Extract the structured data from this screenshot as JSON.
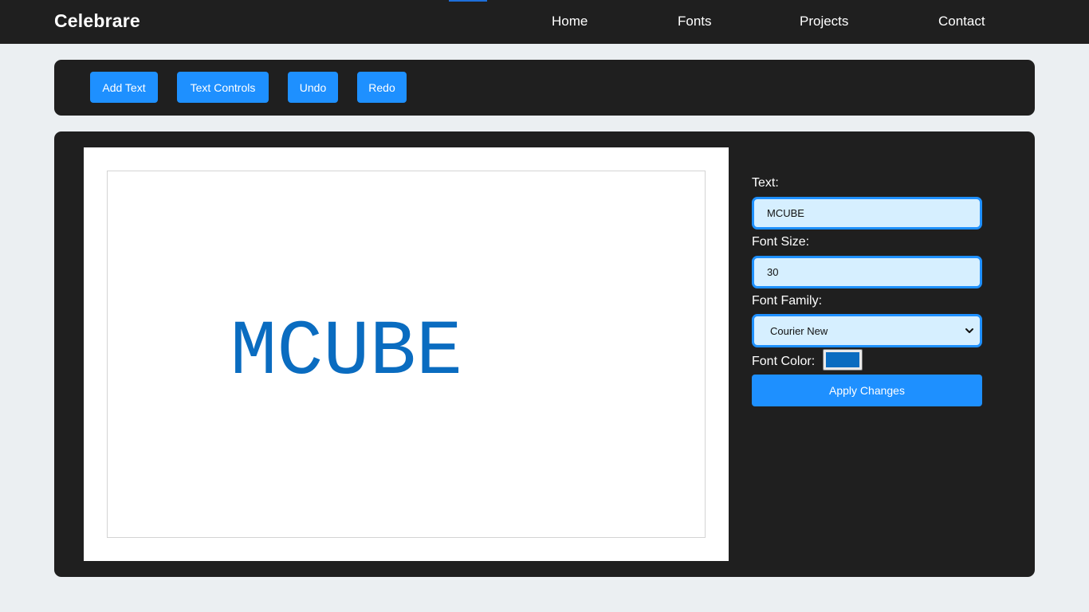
{
  "navbar": {
    "brand": "Celebrare",
    "links": [
      "Home",
      "Fonts",
      "Projects",
      "Contact"
    ]
  },
  "toolbar": {
    "add_text": "Add Text",
    "text_controls": "Text Controls",
    "undo": "Undo",
    "redo": "Redo"
  },
  "canvas": {
    "text": "MCUBE",
    "text_color": "#0a6cc0"
  },
  "controls": {
    "text_label": "Text:",
    "text_value": "MCUBE",
    "font_size_label": "Font Size:",
    "font_size_value": "30",
    "font_family_label": "Font Family:",
    "font_family_value": "Courier New",
    "font_color_label": "Font Color:",
    "font_color_value": "#0a6cc0",
    "apply_label": "Apply Changes"
  },
  "colors": {
    "accent": "#1e90ff",
    "dark_panel": "#1f1f1f",
    "page_bg": "#ebeff2",
    "input_bg": "#d6efff"
  }
}
